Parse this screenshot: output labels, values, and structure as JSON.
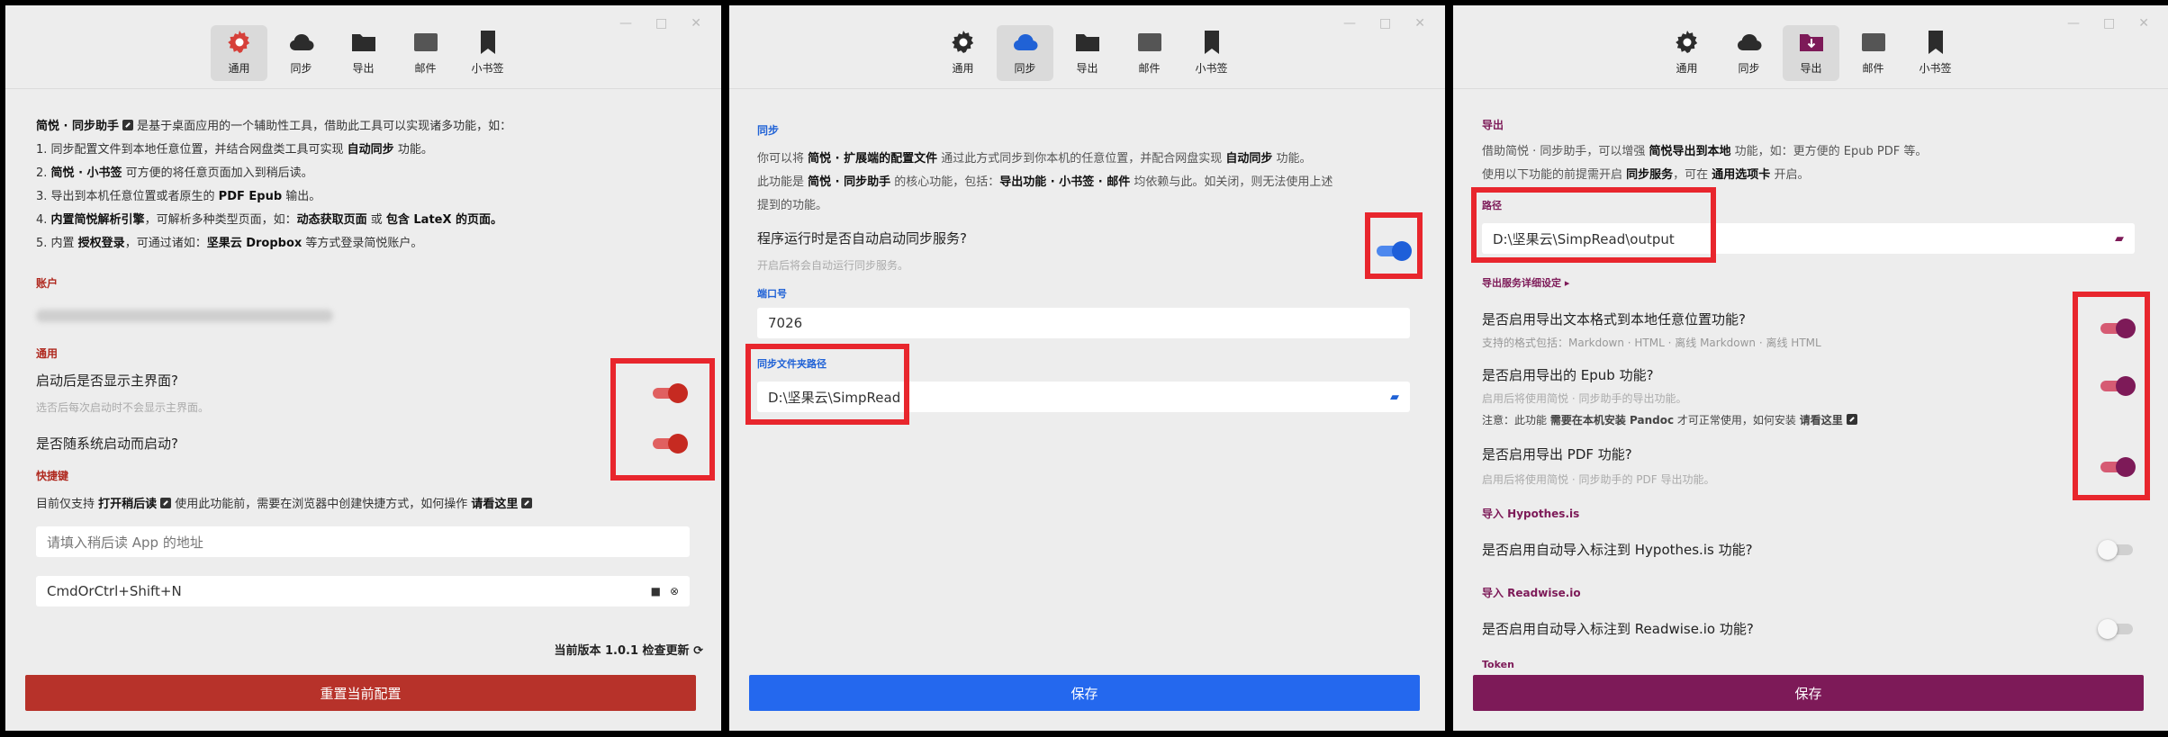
{
  "window_controls": [
    "—",
    "□",
    "✕"
  ],
  "tabs": [
    {
      "label": "通用",
      "icon": "gear-icon"
    },
    {
      "label": "同步",
      "icon": "cloud-icon"
    },
    {
      "label": "导出",
      "icon": "folder-icon"
    },
    {
      "label": "邮件",
      "icon": "mail-icon"
    },
    {
      "label": "小书签",
      "icon": "bookmark-icon"
    }
  ],
  "colors": {
    "general": "#b02a20",
    "sync": "#2062d6",
    "export": "#7d1a58"
  },
  "panel1": {
    "intro": [
      {
        "a": "简悦 · 同步助手",
        "b": " 是基于桌面应用的一个辅助性工具，借助此工具可以实现诸多功能，如："
      },
      {
        "a": "1. 同步配置文件到本地任意位置，并结合网盘类工具可实现 ",
        "b": "自动同步",
        "c": " 功能。"
      },
      {
        "a": "2. ",
        "b": "简悦 · 小书签",
        "c": " 可方便的将任意页面加入到稍后读。"
      },
      {
        "a": "3. 导出到本机任意位置或者原生的 ",
        "b": "PDF Epub",
        "c": " 输出。"
      },
      {
        "a": "4. ",
        "b": "内置简悦解析引擎",
        "c": "，可解析多种类型页面，如：",
        "d": "动态获取页面",
        "e": " 或 ",
        "f": "包含 LateX 的页面。"
      },
      {
        "a": "5. 内置 ",
        "b": "授权登录",
        "c": "，可通过诸如：",
        "d": "坚果云 Dropbox",
        "e": " 等方式登录简悦账户。"
      }
    ],
    "account_label": "账户",
    "general_label": "通用",
    "q1": "启动后是否显示主界面?",
    "q1_hint": "选否后每次启动时不会显示主界面。",
    "q2": "是否随系统启动而启动?",
    "shortcut_label": "快捷键",
    "shortcut_desc_a": "目前仅支持 ",
    "shortcut_desc_b": "打开稍后读",
    "shortcut_desc_c": " 使用此功能前，需要在浏览器中创建快捷方式，如何操作 ",
    "shortcut_desc_d": "请看这里",
    "app_placeholder": "请填入稍后读 App 的地址",
    "hotkey_value": "CmdOrCtrl+Shift+N",
    "version": "当前版本 1.0.1 检查更新",
    "reset_button": "重置当前配置"
  },
  "panel2": {
    "sync_label": "同步",
    "desc1_a": "你可以将 ",
    "desc1_b": "简悦 · 扩展端的配置文件",
    "desc1_c": " 通过此方式同步到你本机的任意位置，并配合网盘实现 ",
    "desc1_d": "自动同步",
    "desc1_e": " 功能。",
    "desc2_a": "此功能是 ",
    "desc2_b": "简悦 · 同步助手",
    "desc2_c": " 的核心功能，包括：",
    "desc2_d": "导出功能 · 小书签 · 邮件",
    "desc2_e": " 均依赖与此。如关闭，则无法使用上述",
    "desc3": "提到的功能。",
    "q_sync": "程序运行时是否自动启动同步服务?",
    "q_sync_hint": "开启后将会自动运行同步服务。",
    "port_label": "端口号",
    "port_value": "7026",
    "folder_label": "同步文件夹路径",
    "folder_value": "D:\\坚果云\\SimpRead",
    "save_button": "保存"
  },
  "panel3": {
    "export_label": "导出",
    "desc1_a": "借助简悦 · 同步助手，可以增强 ",
    "desc1_b": "简悦导出到本地",
    "desc1_c": " 功能，如：更方便的 Epub PDF 等。",
    "desc2_a": "使用以下功能的前提需开启 ",
    "desc2_b": "同步服务",
    "desc2_c": "，可在 ",
    "desc2_d": "通用选项卡",
    "desc2_e": " 开启。",
    "path_label": "路径",
    "path_value": "D:\\坚果云\\SimpRead\\output",
    "detail_label": "导出服务详细设定",
    "q_text": "是否启用导出文本格式到本地任意位置功能?",
    "q_text_hint": "支持的格式包括：Markdown · HTML · 离线 Markdown · 离线 HTML",
    "q_epub": "是否启用导出的 Epub 功能?",
    "q_epub_hint": "启用后将使用简悦 · 同步助手的导出功能。",
    "note_a": "注意：此功能 ",
    "note_b": "需要在本机安装 Pandoc",
    "note_c": " 才可正常使用，如何安装 ",
    "note_d": "请看这里",
    "q_pdf": "是否启用导出 PDF 功能?",
    "q_pdf_hint": "启用后将使用简悦 · 同步助手的 PDF 导出功能。",
    "hyp_label": "导入 Hypothes.is",
    "q_hyp": "是否启用自动导入标注到 Hypothes.is 功能?",
    "rw_label": "导入 Readwise.io",
    "q_rw": "是否启用自动导入标注到 Readwise.io 功能?",
    "token_label": "Token",
    "save_button": "保存"
  },
  "toggles": {
    "show_main_window": true,
    "auto_launch": true,
    "auto_sync": true,
    "export_text": true,
    "export_epub": true,
    "export_pdf": true,
    "hypothesis_import": false,
    "readwise_import": false
  }
}
